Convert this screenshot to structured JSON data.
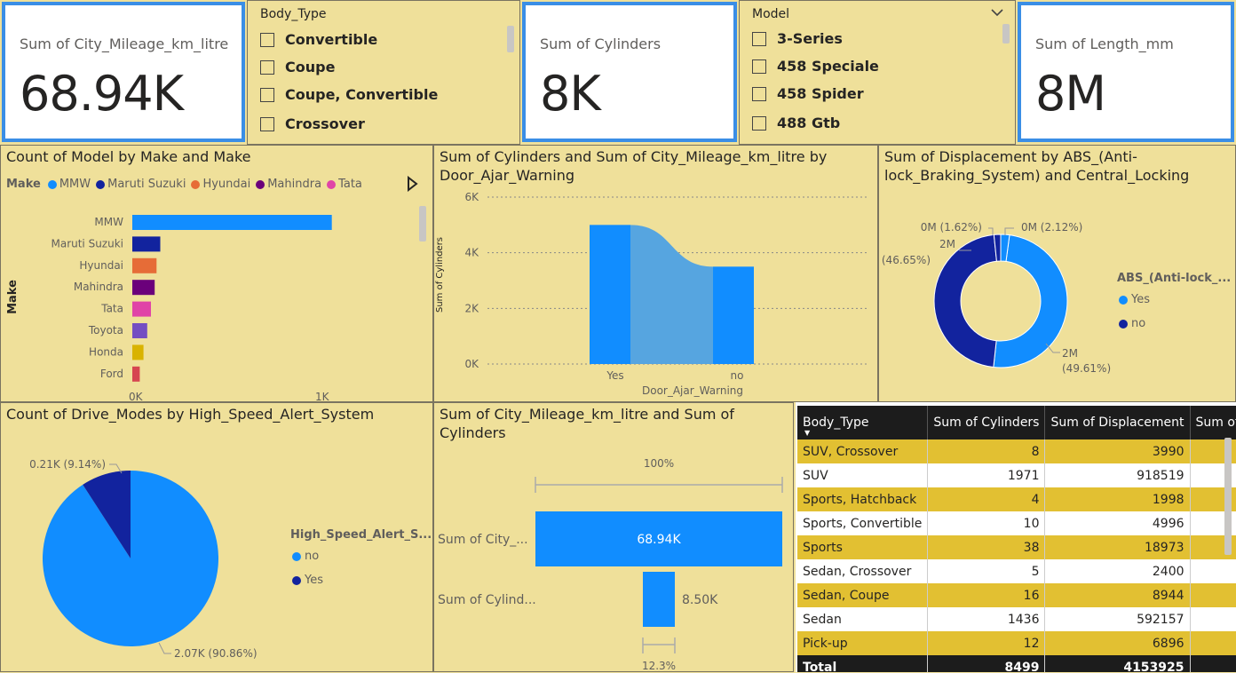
{
  "cards": [
    {
      "label": "Sum of City_Mileage_km_litre",
      "value": "68.94K"
    },
    {
      "label": "Sum of Cylinders",
      "value": "8K"
    },
    {
      "label": "Sum of Length_mm",
      "value": "8M"
    }
  ],
  "slicer_body_type": {
    "title": "Body_Type",
    "items": [
      "Convertible",
      "Coupe",
      "Coupe, Convertible",
      "Crossover"
    ]
  },
  "slicer_model": {
    "title": "Model",
    "items": [
      "3-Series",
      "458 Speciale",
      "458 Spider",
      "488 Gtb"
    ]
  },
  "bar_make": {
    "title": "Count of Model by Make and Make",
    "legend_title": "Make",
    "legend": [
      {
        "name": "MMW",
        "color": "#118dff"
      },
      {
        "name": "Maruti Suzuki",
        "color": "#12239e"
      },
      {
        "name": "Hyundai",
        "color": "#e66c37"
      },
      {
        "name": "Mahindra",
        "color": "#6b007b"
      },
      {
        "name": "Tata",
        "color": "#e044a7"
      }
    ],
    "ylabel": "Make",
    "xticks": [
      "0K",
      "1K"
    ]
  },
  "ribbon": {
    "title": "Sum of Cylinders and Sum of City_Mileage_km_litre by Door_Ajar_Warning",
    "ylabel": "Sum of Cylinders",
    "xlabel": "Door_Ajar_Warning",
    "yticks": [
      "6K",
      "4K",
      "2K",
      "0K"
    ]
  },
  "donut": {
    "title": "Sum of Displacement by ABS_(Anti-lock_Braking_System) and Central_Locking",
    "legend_title": "ABS_(Anti-lock_...",
    "legend": [
      {
        "name": "Yes",
        "color": "#118dff"
      },
      {
        "name": "no",
        "color": "#12239e"
      }
    ],
    "labels": [
      "0M (1.62%)",
      "0M (2.12%)",
      "2M",
      "(46.65%)",
      "2M",
      "(49.61%)"
    ]
  },
  "pie": {
    "title": "Count of Drive_Modes by High_Speed_Alert_System",
    "legend_title": "High_Speed_Alert_S...",
    "legend": [
      {
        "name": "no",
        "color": "#118dff"
      },
      {
        "name": "Yes",
        "color": "#12239e"
      }
    ],
    "labels": [
      "0.21K (9.14%)",
      "2.07K (90.86%)"
    ]
  },
  "funnel": {
    "title": "Sum of City_Mileage_km_litre and Sum of Cylinders",
    "top_pct": "100%",
    "rows": [
      {
        "label": "Sum of City_...",
        "value_label": "68.94K"
      },
      {
        "label": "Sum of Cylind...",
        "value_label": "8.50K"
      }
    ],
    "bottom_pct": "12.3%"
  },
  "chart_data": [
    {
      "type": "bar",
      "title": "Count of Model by Make and Make",
      "ylabel": "Make",
      "categories": [
        "MMW",
        "Maruti Suzuki",
        "Hyundai",
        "Mahindra",
        "Tata",
        "Toyota",
        "Honda",
        "Ford"
      ],
      "values": [
        1070,
        150,
        130,
        120,
        100,
        80,
        60,
        40
      ],
      "colors": [
        "#118dff",
        "#12239e",
        "#e66c37",
        "#6b007b",
        "#e044a7",
        "#744ec2",
        "#d9b300",
        "#d64550"
      ],
      "xlim": [
        0,
        1200
      ]
    },
    {
      "type": "bar",
      "title": "Sum of Cylinders and Sum of City_Mileage_km_litre by Door_Ajar_Warning",
      "xlabel": "Door_Ajar_Warning",
      "ylabel": "Sum of Cylinders",
      "categories": [
        "Yes",
        "no"
      ],
      "series": [
        {
          "values": [
            5000,
            3500
          ]
        }
      ],
      "ylim": [
        0,
        6000
      ]
    },
    {
      "type": "pie",
      "title": "Sum of Displacement by ABS_(Anti-lock_Braking_System) and Central_Locking",
      "slices": [
        {
          "name": "Yes",
          "value": 49.61,
          "color": "#118dff"
        },
        {
          "name": "no",
          "value": 46.65,
          "color": "#12239e"
        },
        {
          "name": "no",
          "value": 1.62,
          "color": "#12239e"
        },
        {
          "name": "Yes",
          "value": 2.12,
          "color": "#118dff"
        }
      ]
    },
    {
      "type": "pie",
      "title": "Count of Drive_Modes by High_Speed_Alert_System",
      "slices": [
        {
          "name": "no",
          "value": 2.07,
          "pct": 90.86,
          "color": "#118dff"
        },
        {
          "name": "Yes",
          "value": 0.21,
          "pct": 9.14,
          "color": "#12239e"
        }
      ]
    },
    {
      "type": "bar",
      "title": "Sum of City_Mileage_km_litre and Sum of Cylinders",
      "categories": [
        "Sum of City_Mileage_km_litre",
        "Sum of Cylinders"
      ],
      "values": [
        68940,
        8500
      ]
    }
  ],
  "matrix": {
    "columns": [
      "Body_Type",
      "Sum of Cylinders",
      "Sum of Displacement",
      "Sum of Fue"
    ],
    "rows": [
      [
        "SUV, Crossover",
        "8",
        "3990"
      ],
      [
        "SUV",
        "1971",
        "918519"
      ],
      [
        "Sports, Hatchback",
        "4",
        "1998"
      ],
      [
        "Sports, Convertible",
        "10",
        "4996"
      ],
      [
        "Sports",
        "38",
        "18973"
      ],
      [
        "Sedan, Crossover",
        "5",
        "2400"
      ],
      [
        "Sedan, Coupe",
        "16",
        "8944"
      ],
      [
        "Sedan",
        "1436",
        "592157"
      ],
      [
        "Pick-up",
        "12",
        "6896"
      ]
    ],
    "total": [
      "Total",
      "8499",
      "4153925"
    ]
  }
}
